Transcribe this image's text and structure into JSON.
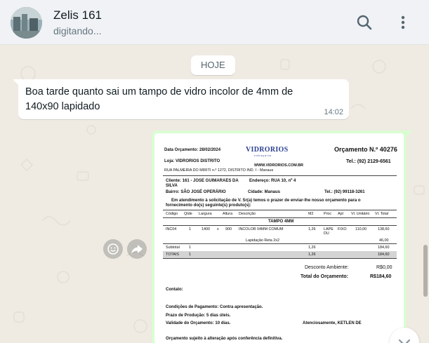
{
  "header": {
    "contact_name": "Zelis 161",
    "status": "digitando..."
  },
  "chat": {
    "date_chip": "HOJE",
    "incoming": {
      "text": "Boa tarde quanto sai um tampo de vidro incolor de 4mm  de 140x90 lapidado",
      "time": "14:02"
    }
  },
  "quote": {
    "date_label": "Data Orçamento: 28/02/2024",
    "logo": "VIDRORIOS",
    "logo_sub": "vidraçaria",
    "number_label": "Orçamento N.º 40276",
    "store": "Loja: VIDRORIOS DISTRITO",
    "website": "WWW.VIDRORIOS.COM.BR",
    "phone": "Tel.: (92) 2129-6561",
    "store_address": "RUA PALMEIRA DO MIRITI n.º 1272, DISTRITO IND. I - Manaus",
    "client_line1": "Cliente: 161 - JOSE GUIMARAES DA",
    "client_line2": "SILVA",
    "address": "Endereço: RUA 10, nº 4",
    "district": "Bairro: SÃO JOSÉ OPERÁRIO",
    "city": "Cidade: Manaus",
    "client_phone": "Tel.: (92) 99118-3261",
    "intro_line1": "Em atendimento à solicitação de V. Sr(a) temos o prazer de enviar-lhe nosso orçamento para o",
    "intro_line2": "fornecimento do(s) seguinte(s) produto(s):",
    "columns": {
      "code": "Código",
      "qty": "Qtde",
      "width": "Largura",
      "height": "Altura",
      "desc": "Descrição",
      "m2": "M2",
      "proc": "Proc",
      "apl": "Apl",
      "unit": "Vl. Unitário",
      "total": "Vl. Total"
    },
    "section": "TAMPO 4MM",
    "item": {
      "code": "INC04",
      "qty": "1",
      "width": "1400",
      "x": "x",
      "height": "900",
      "desc": "INCOLOR 04MM COMUM",
      "m2": "1,26",
      "proc_line1": "LAPE",
      "proc_line2": "DU",
      "apl": "FIXO",
      "unit": "110,00",
      "total": "138,60"
    },
    "extra": {
      "desc": "Lapidação Reta 2x2",
      "total": "46,00"
    },
    "subtotal": {
      "label": "Subtotal",
      "qty": "1",
      "m2": "1,26",
      "total": "184,60"
    },
    "totals": {
      "label": "TOTAIS",
      "qty": "1",
      "m2": "1,26",
      "total": "184,60"
    },
    "discount_label": "Desconto Ambiente:",
    "discount_value": "R$0,00",
    "grand_label": "Total do Orçamento:",
    "grand_value": "R$184,60",
    "contact": "Contato:",
    "payment": "Condições de Pagamento: Contra apresentação.",
    "production": "Prazo de Produção:  5 dias úteis.",
    "validity": "Validade do Orçamento:  10 dias.",
    "signature": "Atenciosamente, KETLEN DE",
    "footer": "Orçamento sujeito à alteração após conferência definitiva."
  },
  "colors": {
    "header_bg": "#f0f2f5",
    "chat_bg": "#efeae2",
    "outgoing_bubble": "#d9fdd3",
    "incoming_bubble": "#ffffff",
    "brand_logo": "#2a3f8f"
  },
  "icons": {
    "search": "search-icon",
    "menu": "kebab-menu-icon",
    "smiley": "smiley-icon",
    "forward": "forward-icon",
    "scroll_down": "chevron-down-icon"
  }
}
